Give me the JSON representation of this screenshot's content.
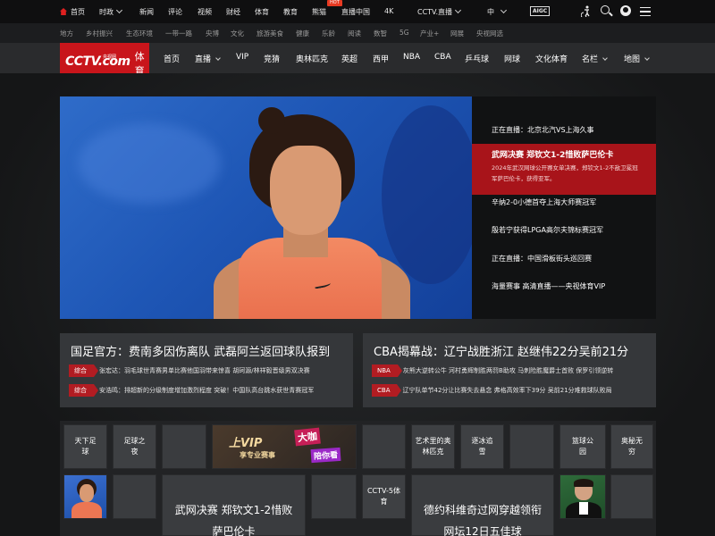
{
  "top_nav": {
    "items": [
      "首页",
      "时政",
      "新闻",
      "评论",
      "视频",
      "财经",
      "体育",
      "教育",
      "熊猫",
      "直播中国",
      "4K"
    ],
    "hot_badge": "HOT",
    "live_select": "CCTV.直播",
    "language": "中",
    "aigc_badge": "AIGC"
  },
  "sub_nav": {
    "items": [
      "地方",
      "乡村振兴",
      "生态环境",
      "一带一路",
      "央博",
      "文化",
      "旅游美食",
      "健康",
      "乐龄",
      "阅读",
      "数智",
      "5G",
      "产业+",
      "网展",
      "央视网选"
    ]
  },
  "main_nav": {
    "logo_text": "CCTV.com",
    "logo_small": "央视网",
    "logo_section": "体育",
    "items": [
      "首页",
      "直播",
      "VIP",
      "竞猜",
      "奥林匹克",
      "英超",
      "西甲",
      "NBA",
      "CBA",
      "乒乓球",
      "网球",
      "文化体育",
      "名栏",
      "地图"
    ]
  },
  "hero": {
    "list": [
      "正在直播：北京北汽VS上海久事",
      "武网决赛 郑钦文1-2惜败萨巴伦卡",
      "辛纳2-0小德首夺上海大师赛冠军",
      "殷若宁获得LPGA高尔夫锦标赛冠军",
      "正在直播：中国滑板街头巡回赛",
      "海量赛事 高清直播——央视体育VIP"
    ],
    "active_desc": "2024年武汉网球公开赛女单决赛，郑钦文1-2不敌卫冕冠军萨巴伦卡，获得亚军。"
  },
  "cards": {
    "left": {
      "title": "国足官方：费南多因伤离队 武磊阿兰返回球队报到",
      "rows": [
        {
          "tag": "综合",
          "text": "张宏达：羽毛球世青赛男单比赛他国羽带来惊喜 胡珂源/林祥毅晋级男双决赛"
        },
        {
          "tag": "综合",
          "text": "安浩鸣：排超新的分级制度增加激烈程度 突破！中国队高台跳水获世青赛冠军"
        }
      ]
    },
    "right": {
      "title": "CBA揭幕战：辽宁战胜浙江 赵继伟22分吴前21分",
      "rows": [
        {
          "tag": "NBA",
          "text": "灰熊大逆转公牛 河村勇辉制胜两罚B助攻 马刺险胜魔爵士首败 保罗引领逆转"
        },
        {
          "tag": "CBA",
          "text": "辽宁队单节42分让比赛失去悬念 弗格高效率下39分 吴前21分难救球队败局"
        }
      ]
    }
  },
  "grid": {
    "tiles": [
      "天下足球",
      "足球之夜",
      "艺术里的奥林匹克",
      "逐冰追雪",
      "篮球公园",
      "奥秘无穷",
      "CCTV-5体育"
    ],
    "vip_title": "上VIP",
    "vip_sub": "享专业赛事",
    "vip_badge1": "大咖",
    "vip_badge2": "陪你看",
    "big_left": [
      "武网决赛 郑钦文1-2惜败",
      "萨巴伦卡"
    ],
    "big_right": [
      "德约科维奇过网穿越领衔",
      "网坛12日五佳球"
    ]
  },
  "colors": {
    "brand_red": "#c8151b",
    "active_red": "#a8141a",
    "tag_red": "#b21c22"
  }
}
